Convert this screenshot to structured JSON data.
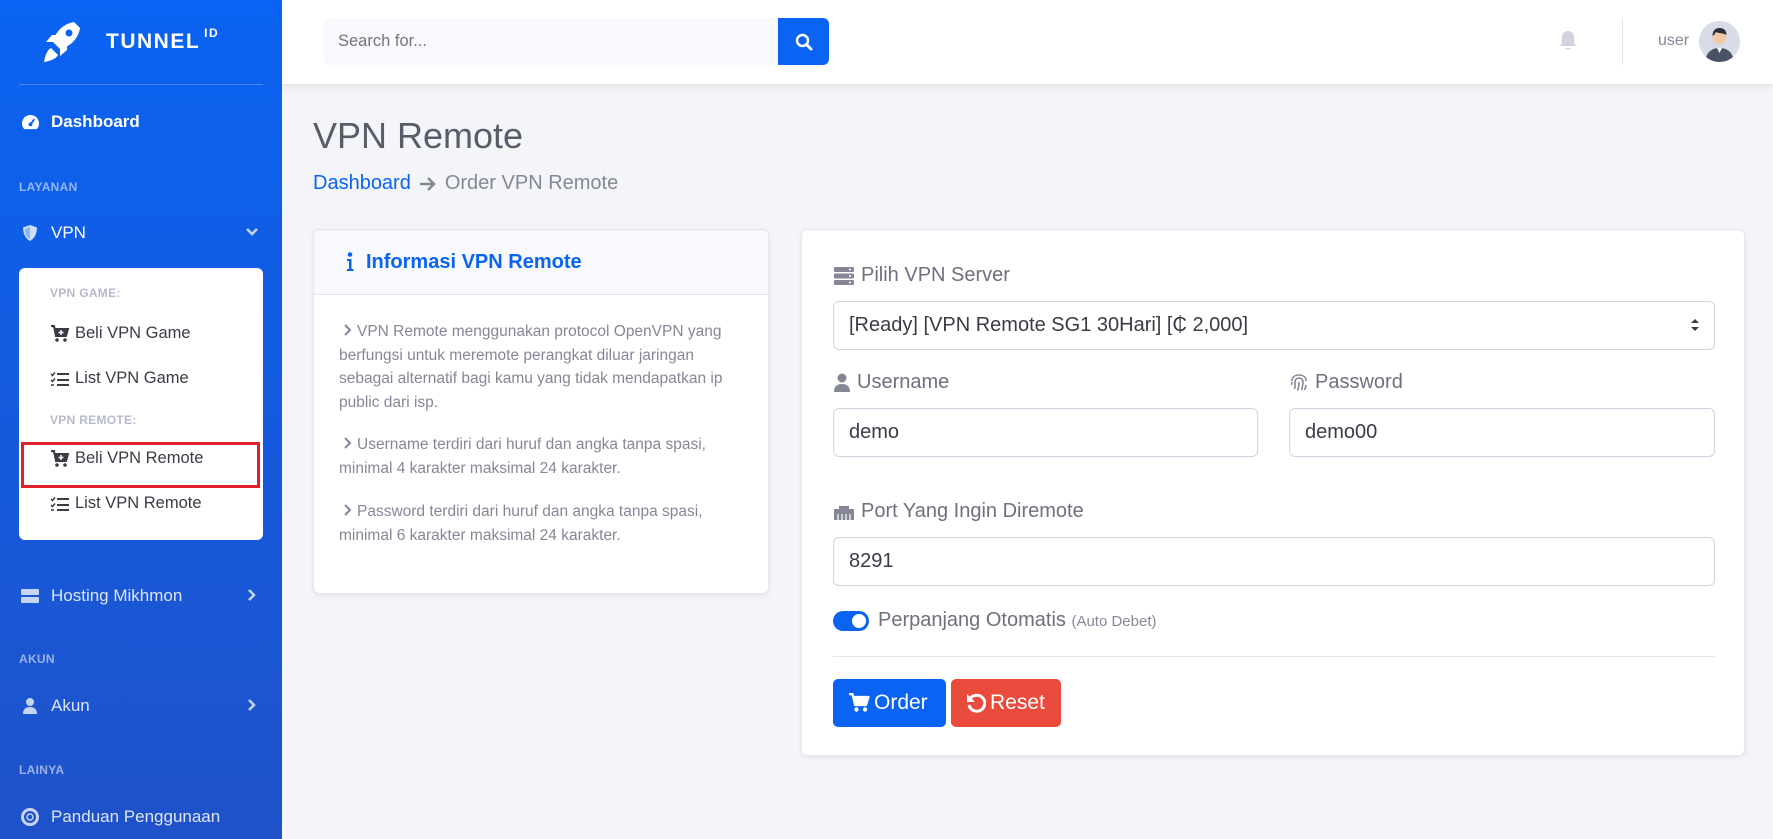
{
  "brand": {
    "name": "TUNNEL",
    "sup": "ID"
  },
  "sidebar": {
    "dashboard": "Dashboard",
    "heading_layanan": "LAYANAN",
    "vpn": "VPN",
    "vpn_game_heading": "VPN GAME:",
    "beli_vpn_game": "Beli VPN Game",
    "list_vpn_game": "List VPN Game",
    "vpn_remote_heading": "VPN REMOTE:",
    "beli_vpn_remote": "Beli VPN Remote",
    "list_vpn_remote": "List VPN Remote",
    "hosting": "Hosting Mikhmon",
    "heading_akun": "AKUN",
    "akun": "Akun",
    "heading_lainya": "LAINYA",
    "panduan": "Panduan Penggunaan"
  },
  "topbar": {
    "search_placeholder": "Search for...",
    "user_name": "user"
  },
  "page": {
    "title": "VPN Remote",
    "breadcrumb_link": "Dashboard",
    "breadcrumb_current": "Order VPN Remote"
  },
  "info_card": {
    "title": "Informasi VPN Remote",
    "items": [
      "VPN Remote menggunakan protocol OpenVPN yang berfungsi untuk meremote perangkat diluar jaringan sebagai alternatif bagi kamu yang tidak mendapatkan ip public dari isp.",
      "Username terdiri dari huruf dan angka tanpa spasi, minimal 4 karakter maksimal 24 karakter.",
      "Password terdiri dari huruf dan angka tanpa spasi, minimal 6 karakter maksimal 24 karakter."
    ]
  },
  "form": {
    "server_label": "Pilih VPN Server",
    "server_value": "[Ready] [VPN Remote SG1 30Hari] [₵ 2,000]",
    "username_label": "Username",
    "username_value": "demo",
    "password_label": "Password",
    "password_value": "demo00",
    "port_label": "Port Yang Ingin Diremote",
    "port_value": "8291",
    "auto_label": "Perpanjang Otomatis",
    "auto_note": "(Auto Debet)",
    "auto_enabled": true,
    "order_button": "Order",
    "reset_button": "Reset"
  },
  "colors": {
    "primary": "#0b63f3",
    "danger": "#e94b3c",
    "highlight": "#e0202a"
  }
}
